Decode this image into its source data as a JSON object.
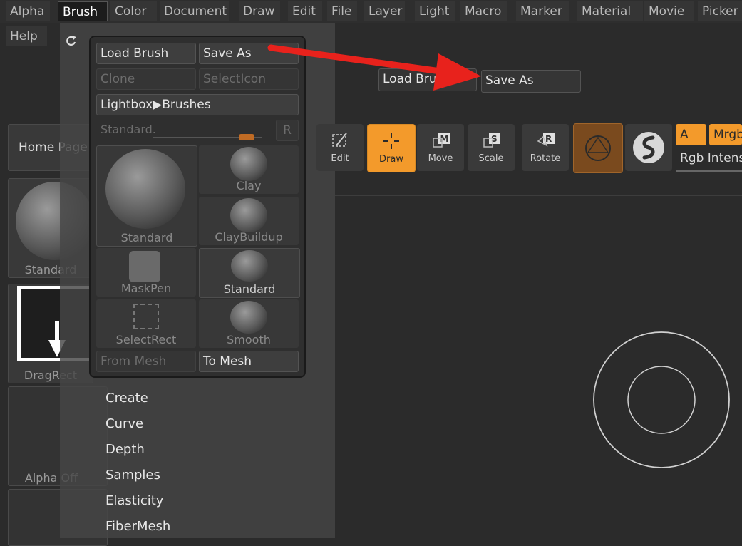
{
  "menubar": {
    "items": [
      "Alpha",
      "Brush",
      "Color",
      "Document",
      "Draw",
      "Edit",
      "File",
      "Layer",
      "Light",
      "Macro",
      "Marker",
      "Material",
      "Movie",
      "Picker"
    ],
    "active": "Brush",
    "help": "Help"
  },
  "shelf": {
    "home_page": "Home Page",
    "standard": "Standard",
    "dragrect": "DragRect",
    "alpha_off": "Alpha Off"
  },
  "popup": {
    "load_brush": "Load Brush",
    "save_as": "Save As",
    "clone": "Clone",
    "select_icon": "SelectIcon",
    "lightbox_brushes": "Lightbox▶Brushes",
    "current_brush": "Standard.",
    "r_button": "R",
    "tiles": [
      "Standard",
      "Clay",
      "ClayBuildup",
      "MaskPen",
      "Standard",
      "SelectRect",
      "Smooth"
    ],
    "from_mesh": "From Mesh",
    "to_mesh": "To Mesh"
  },
  "floating": {
    "load_brush": "Load Brush",
    "save_as": "Save As"
  },
  "toolbar": {
    "edit": "Edit",
    "draw": "Draw",
    "move": "Move",
    "scale": "Scale",
    "rotate": "Rotate",
    "a_label": "A",
    "mrgb_label": "Mrgb",
    "rgb_intensity": "Rgb Intens"
  },
  "submenu": [
    "Create",
    "Curve",
    "Depth",
    "Samples",
    "Elasticity",
    "FiberMesh"
  ],
  "colors": {
    "accent_orange": "#f39a2b",
    "arrow_red": "#e8221c"
  }
}
